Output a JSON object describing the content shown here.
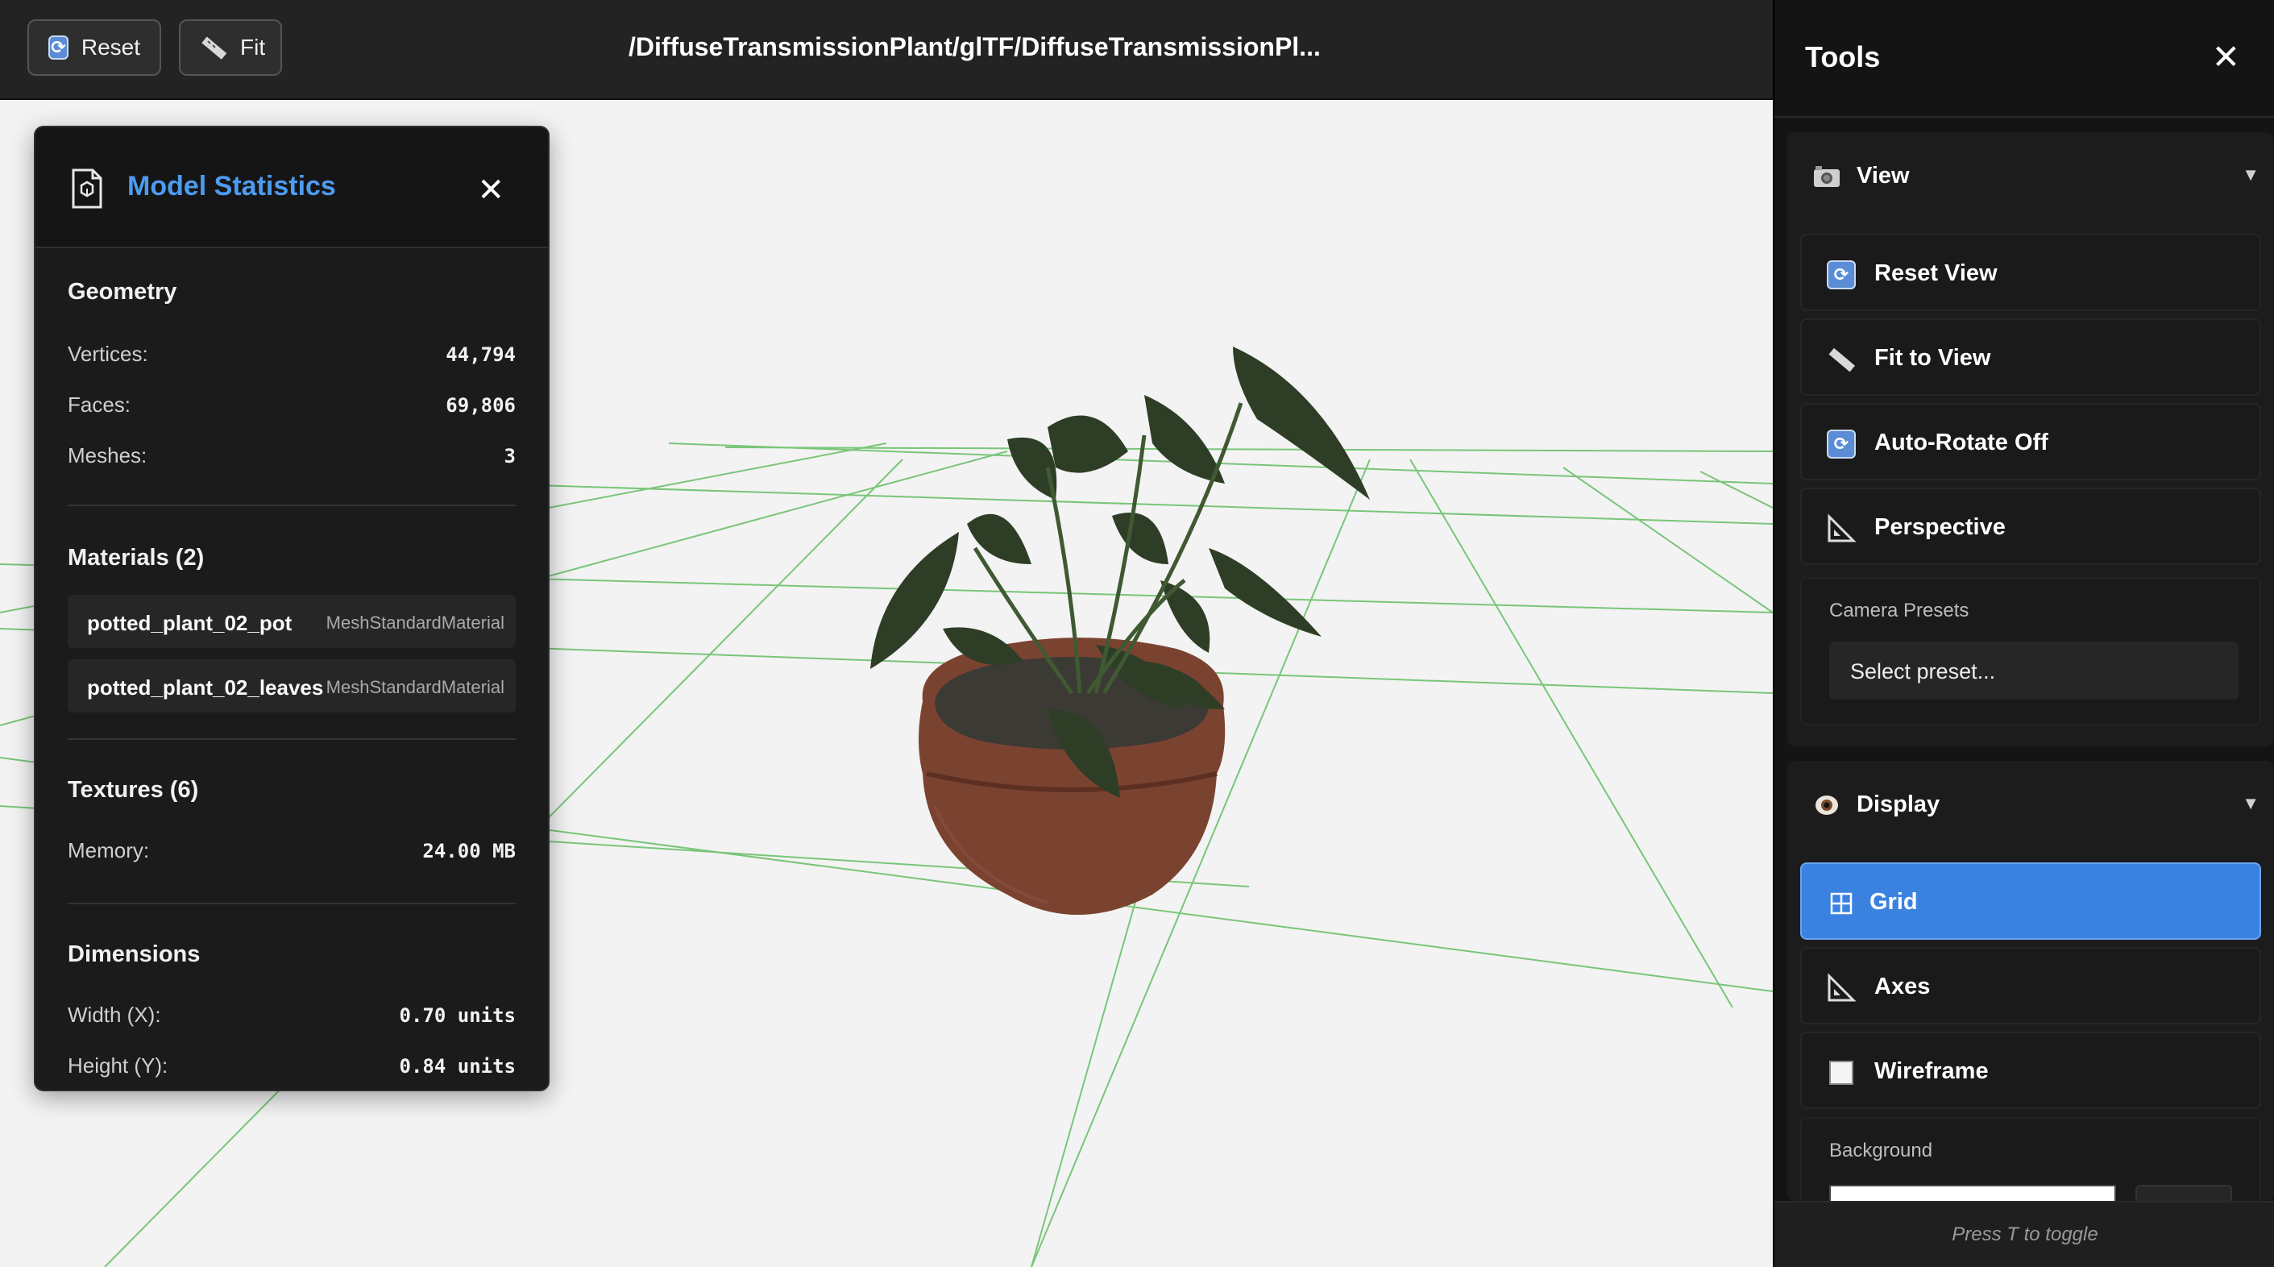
{
  "toolbar": {
    "reset_label": "Reset",
    "fit_label": "Fit",
    "title": "/DiffuseTransmissionPlant/glTF/DiffuseTransmissionPl..."
  },
  "stats": {
    "title": "Model Statistics",
    "close": "✕",
    "geometry": {
      "title": "Geometry",
      "rows": [
        {
          "label": "Vertices:",
          "value": "44,794"
        },
        {
          "label": "Faces:",
          "value": "69,806"
        },
        {
          "label": "Meshes:",
          "value": "3"
        }
      ]
    },
    "materials": {
      "title": "Materials (2)",
      "items": [
        {
          "name": "potted_plant_02_pot",
          "type": "MeshStandardMaterial"
        },
        {
          "name": "potted_plant_02_leaves",
          "type": "MeshStandardMaterial"
        }
      ]
    },
    "textures": {
      "title": "Textures (6)",
      "memory_label": "Memory:",
      "memory_value": "24.00 MB"
    },
    "dimensions": {
      "title": "Dimensions",
      "rows": [
        {
          "label": "Width (X):",
          "value": "0.70 units"
        },
        {
          "label": "Height (Y):",
          "value": "0.84 units"
        }
      ]
    }
  },
  "tools": {
    "title": "Tools",
    "close": "✕",
    "view": {
      "title": "View",
      "caret": "▼",
      "buttons": [
        "Reset View",
        "Fit to View",
        "Auto-Rotate Off",
        "Perspective"
      ],
      "presets_label": "Camera Presets",
      "presets_value": "Select preset..."
    },
    "display": {
      "title": "Display",
      "caret": "▼",
      "buttons": [
        "Grid",
        "Axes",
        "Wireframe"
      ],
      "active": "Grid",
      "background_label": "Background"
    },
    "footer": "Press T to toggle"
  },
  "colors": {
    "accent": "#3b82e0",
    "title_blue": "#4d9bf0",
    "grid_line": "#6cc16c"
  }
}
